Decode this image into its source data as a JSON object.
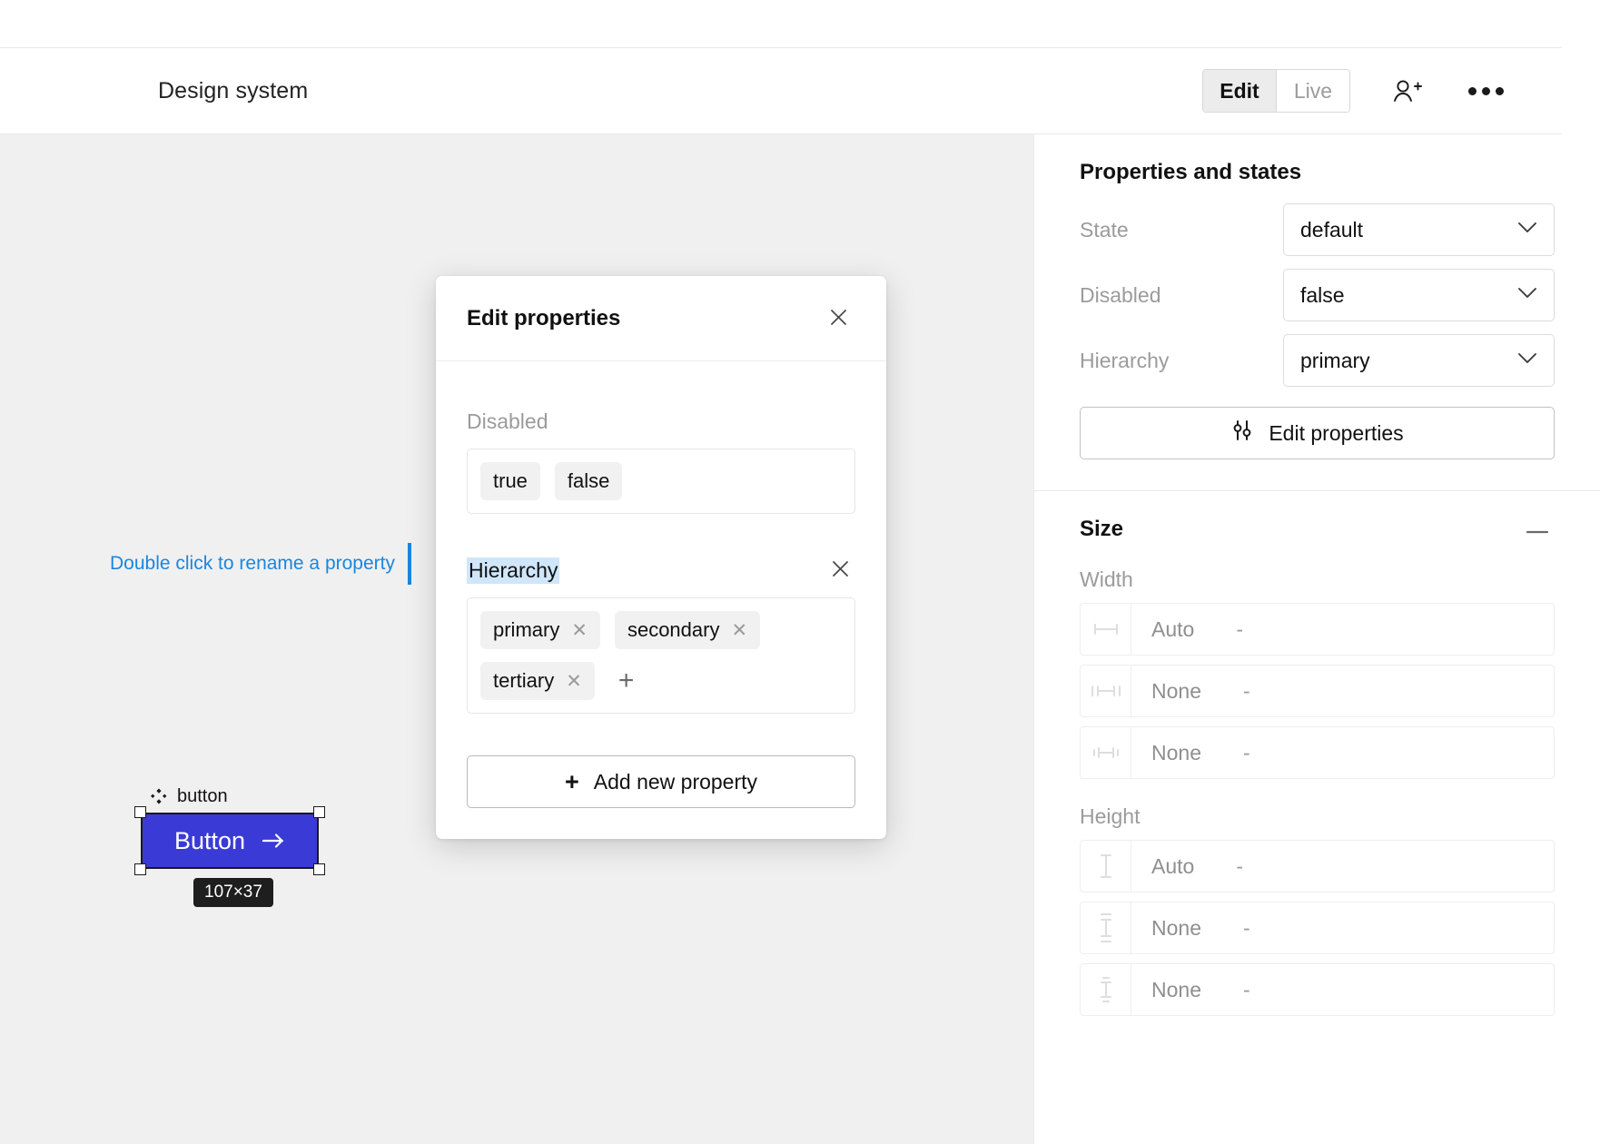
{
  "topbar": {
    "document_title": "Design system",
    "mode_toggle": {
      "options": [
        "Edit",
        "Live"
      ],
      "selected": "Edit"
    },
    "invite_icon": "person-add-icon",
    "more_icon": "more-horizontal-icon"
  },
  "canvas": {
    "hint_text": "Double click to rename a property",
    "hint_color": "#1a86e0",
    "component": {
      "layer_name": "button",
      "layer_icon": "component-diamond-icon",
      "label": "Button",
      "trailing_icon": "arrow-right-icon",
      "fill_color": "#3a3bd6",
      "size_badge": "107×37"
    }
  },
  "modal": {
    "title": "Edit properties",
    "close_icon": "close-icon",
    "properties": [
      {
        "name": "Disabled",
        "selected": false,
        "removable": false,
        "values": [
          {
            "label": "true",
            "removable": false
          },
          {
            "label": "false",
            "removable": false
          }
        ],
        "can_add_value": false
      },
      {
        "name": "Hierarchy",
        "selected": true,
        "removable": true,
        "values": [
          {
            "label": "primary",
            "removable": true
          },
          {
            "label": "secondary",
            "removable": true
          },
          {
            "label": "tertiary",
            "removable": true
          }
        ],
        "can_add_value": true,
        "add_value_glyph": "+"
      }
    ],
    "add_property_label": "Add new property",
    "add_property_icon": "plus-icon"
  },
  "panel": {
    "properties_section": {
      "title": "Properties and states",
      "rows": [
        {
          "label": "State",
          "value": "default",
          "icon": "chevron-down-icon"
        },
        {
          "label": "Disabled",
          "value": "false",
          "icon": "chevron-down-icon"
        },
        {
          "label": "Hierarchy",
          "value": "primary",
          "icon": "chevron-down-icon"
        }
      ],
      "edit_properties_label": "Edit properties",
      "edit_properties_icon": "sliders-icon"
    },
    "size_section": {
      "title": "Size",
      "collapse_icon": "minus-icon",
      "width_label": "Width",
      "width_rows": [
        {
          "icon": "width-icon",
          "value": "Auto",
          "unit": "-"
        },
        {
          "icon": "min-width-icon",
          "value": "None",
          "unit": "-"
        },
        {
          "icon": "max-width-icon",
          "value": "None",
          "unit": "-"
        }
      ],
      "height_label": "Height",
      "height_rows": [
        {
          "icon": "height-icon",
          "value": "Auto",
          "unit": "-"
        },
        {
          "icon": "min-height-icon",
          "value": "None",
          "unit": "-"
        },
        {
          "icon": "max-height-icon",
          "value": "None",
          "unit": "-"
        }
      ]
    }
  }
}
